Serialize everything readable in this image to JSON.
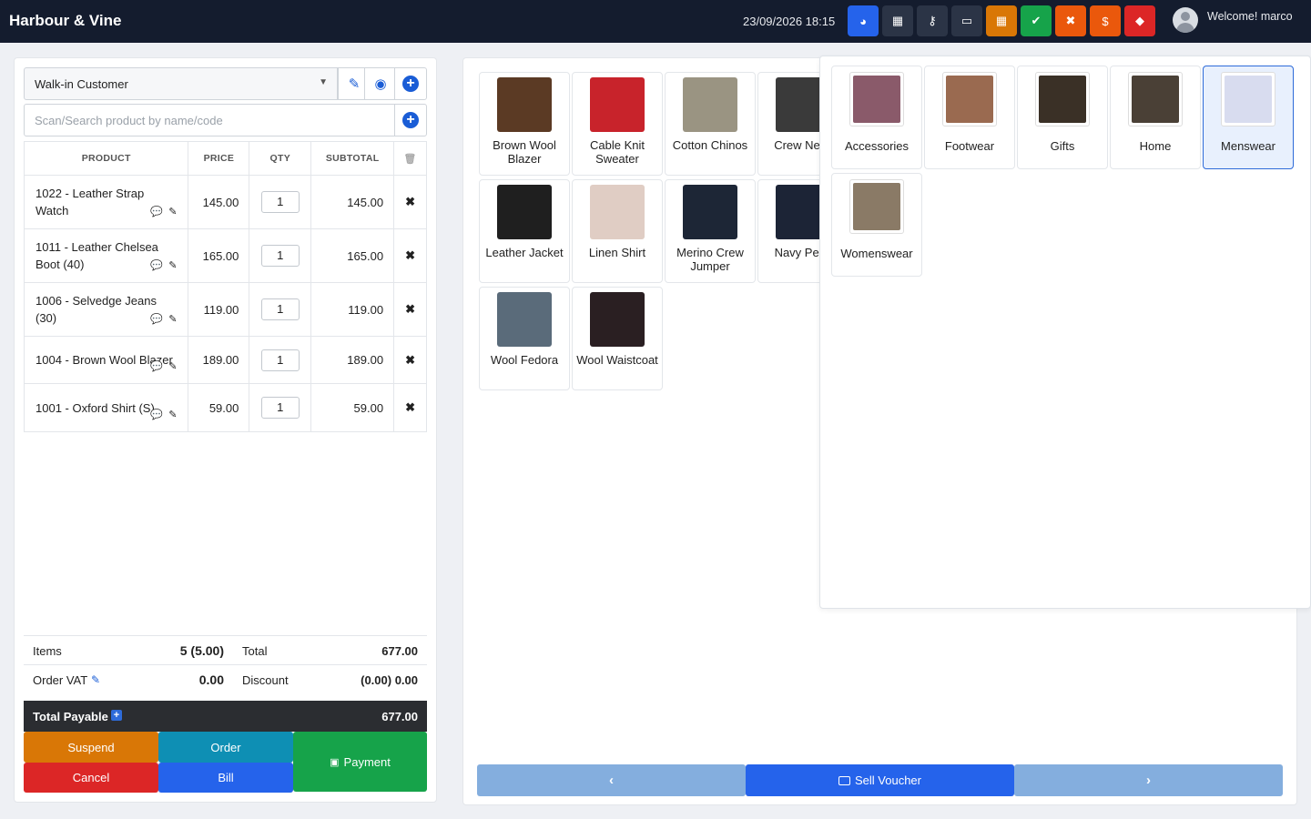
{
  "header": {
    "brand": "Harbour & Vine",
    "datetime": "23/09/2026 18:15",
    "welcome": "Welcome! marco",
    "toolbar": [
      {
        "name": "dashboard-icon",
        "glyph": "◕",
        "color": "#2563eb"
      },
      {
        "name": "calculator-icon",
        "glyph": "▦",
        "color": "#2b3446"
      },
      {
        "name": "key-icon",
        "glyph": "⚷",
        "color": "#2b3446"
      },
      {
        "name": "laptop-icon",
        "glyph": "▭",
        "color": "#2b3446"
      },
      {
        "name": "grid-icon",
        "glyph": "▦",
        "color": "#d97706"
      },
      {
        "name": "check-circle-icon",
        "glyph": "✔",
        "color": "#16a34a"
      },
      {
        "name": "close-circle-icon",
        "glyph": "✖",
        "color": "#ea580c"
      },
      {
        "name": "dollar-icon",
        "glyph": "$",
        "color": "#ea580c"
      },
      {
        "name": "eraser-icon",
        "glyph": "◆",
        "color": "#dc2626"
      }
    ]
  },
  "customer": {
    "selected": "Walk-in Customer"
  },
  "search": {
    "placeholder": "Scan/Search product by name/code"
  },
  "cart": {
    "columns": {
      "product": "PRODUCT",
      "price": "PRICE",
      "qty": "QTY",
      "subtotal": "SUBTOTAL"
    },
    "rows": [
      {
        "product": "1022 - Leather Strap Watch",
        "price": "145.00",
        "qty": "1",
        "subtotal": "145.00"
      },
      {
        "product": "1011 - Leather Chelsea Boot (40)",
        "price": "165.00",
        "qty": "1",
        "subtotal": "165.00"
      },
      {
        "product": "1006 - Selvedge Jeans (30)",
        "price": "119.00",
        "qty": "1",
        "subtotal": "119.00"
      },
      {
        "product": "1004 - Brown Wool Blazer",
        "price": "189.00",
        "qty": "1",
        "subtotal": "189.00"
      },
      {
        "product": "1001 - Oxford Shirt (S)",
        "price": "59.00",
        "qty": "1",
        "subtotal": "59.00"
      }
    ]
  },
  "totals": {
    "items_label": "Items",
    "items_value": "5 (5.00)",
    "total_label": "Total",
    "total_value": "677.00",
    "vat_label": "Order VAT",
    "vat_value": "0.00",
    "discount_label": "Discount",
    "discount_value": "(0.00) 0.00",
    "payable_label": "Total Payable",
    "payable_value": "677.00"
  },
  "actions": {
    "suspend": "Suspend",
    "order": "Order",
    "payment": "Payment",
    "cancel": "Cancel",
    "bill": "Bill"
  },
  "products": [
    {
      "name": "Brown Wool Blazer",
      "color": "#5b3a24"
    },
    {
      "name": "Cable Knit Sweater",
      "color": "#c8232b"
    },
    {
      "name": "Cotton Chinos",
      "color": "#9a9482"
    },
    {
      "name": "Crew Neck",
      "color": "#3a3a3a"
    },
    {
      "name": "Leather Jacket",
      "color": "#1f1f1f"
    },
    {
      "name": "Linen Shirt",
      "color": "#e0cdc4"
    },
    {
      "name": "Merino Crew Jumper",
      "color": "#1d2636"
    },
    {
      "name": "Navy Peac",
      "color": "#1c2436"
    },
    {
      "name": "Wool Fedora",
      "color": "#5a6b7a"
    },
    {
      "name": "Wool Waistcoat",
      "color": "#2a1f22"
    }
  ],
  "categories": [
    {
      "name": "Accessories",
      "color": "#8a5a6a",
      "active": false
    },
    {
      "name": "Footwear",
      "color": "#9a6a50",
      "active": false
    },
    {
      "name": "Gifts",
      "color": "#3a3026",
      "active": false
    },
    {
      "name": "Home",
      "color": "#4a4036",
      "active": false
    },
    {
      "name": "Menswear",
      "color": "#d8dcef",
      "active": true
    },
    {
      "name": "Womenswear",
      "color": "#8a7a66",
      "active": false
    }
  ],
  "footer": {
    "sell_voucher": "Sell Voucher"
  },
  "colors": {
    "primary": "#2563eb",
    "nav_disabled": "#84aede",
    "suspend": "#d97706",
    "order": "#0e8fb4",
    "payment": "#16a34a",
    "cancel": "#dc2626",
    "bill": "#2563eb"
  }
}
